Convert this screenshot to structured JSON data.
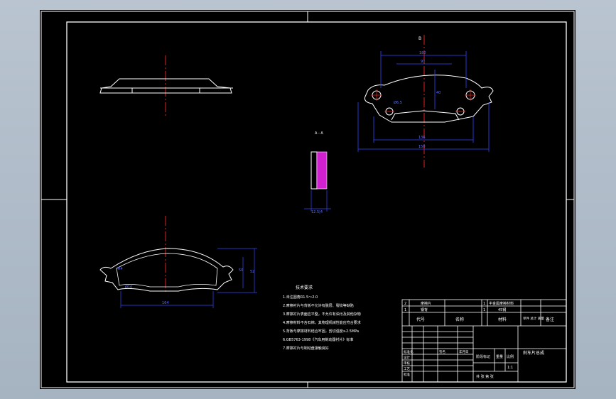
{
  "colors": {
    "background": "#000000",
    "frame": "#ffffff",
    "centerline": "#e02020",
    "dimension": "#3344ff",
    "friction_fill": "#d020d0"
  },
  "views": {
    "top_view_label": "B",
    "section_label": "A - A",
    "section_dim": "12.5|4"
  },
  "dimensions": {
    "top": {
      "overall": "180",
      "inner": "90",
      "bottom_span": "136",
      "outer": "150",
      "hole": "Ø6.5",
      "height": "40"
    },
    "front": {
      "width": "164",
      "height_a": "50",
      "height_b": "52",
      "hole": "Ø10",
      "radius": "R4"
    }
  },
  "notes": {
    "title": "技术要求",
    "lines": [
      "1.未注圆角R1.5～2.0",
      "2.摩擦衬片与背板不允许有脱层、裂纹等缺陷",
      "3.摩擦衬片表面应平整，不允许有油污及其他杂物",
      "4.摩擦材料不含石棉，其物理机械性能应符合要求",
      "5.背板与摩擦材料结合牢固，剪切强度≥2.5MPa",
      "6.GB5763-1998《汽车用制动器衬片》标准",
      "7.摩擦衬片与制动盘接触良好"
    ]
  },
  "title_block": {
    "parts": [
      {
        "no": "2",
        "name": "摩擦片",
        "material": "半金属摩擦材料",
        "qty": "1"
      },
      {
        "no": "1",
        "name": "钢背",
        "material": "45钢",
        "qty": "1"
      }
    ],
    "headers": {
      "no": "代号",
      "name": "名称",
      "material": "材料",
      "mass": "单件 总计 质量",
      "remark": "备注"
    },
    "drawing_title": "刹车片总成",
    "scale_label": "比例",
    "scale": "1:1",
    "stage_label": "阶段标记",
    "weight_label": "重量",
    "sheet_label": "共  张  第  张",
    "labels": {
      "design": "设计",
      "check": "审核",
      "process": "工艺",
      "approve": "批准",
      "standard": "标准化",
      "sign": "签名",
      "date": "年月日"
    }
  }
}
